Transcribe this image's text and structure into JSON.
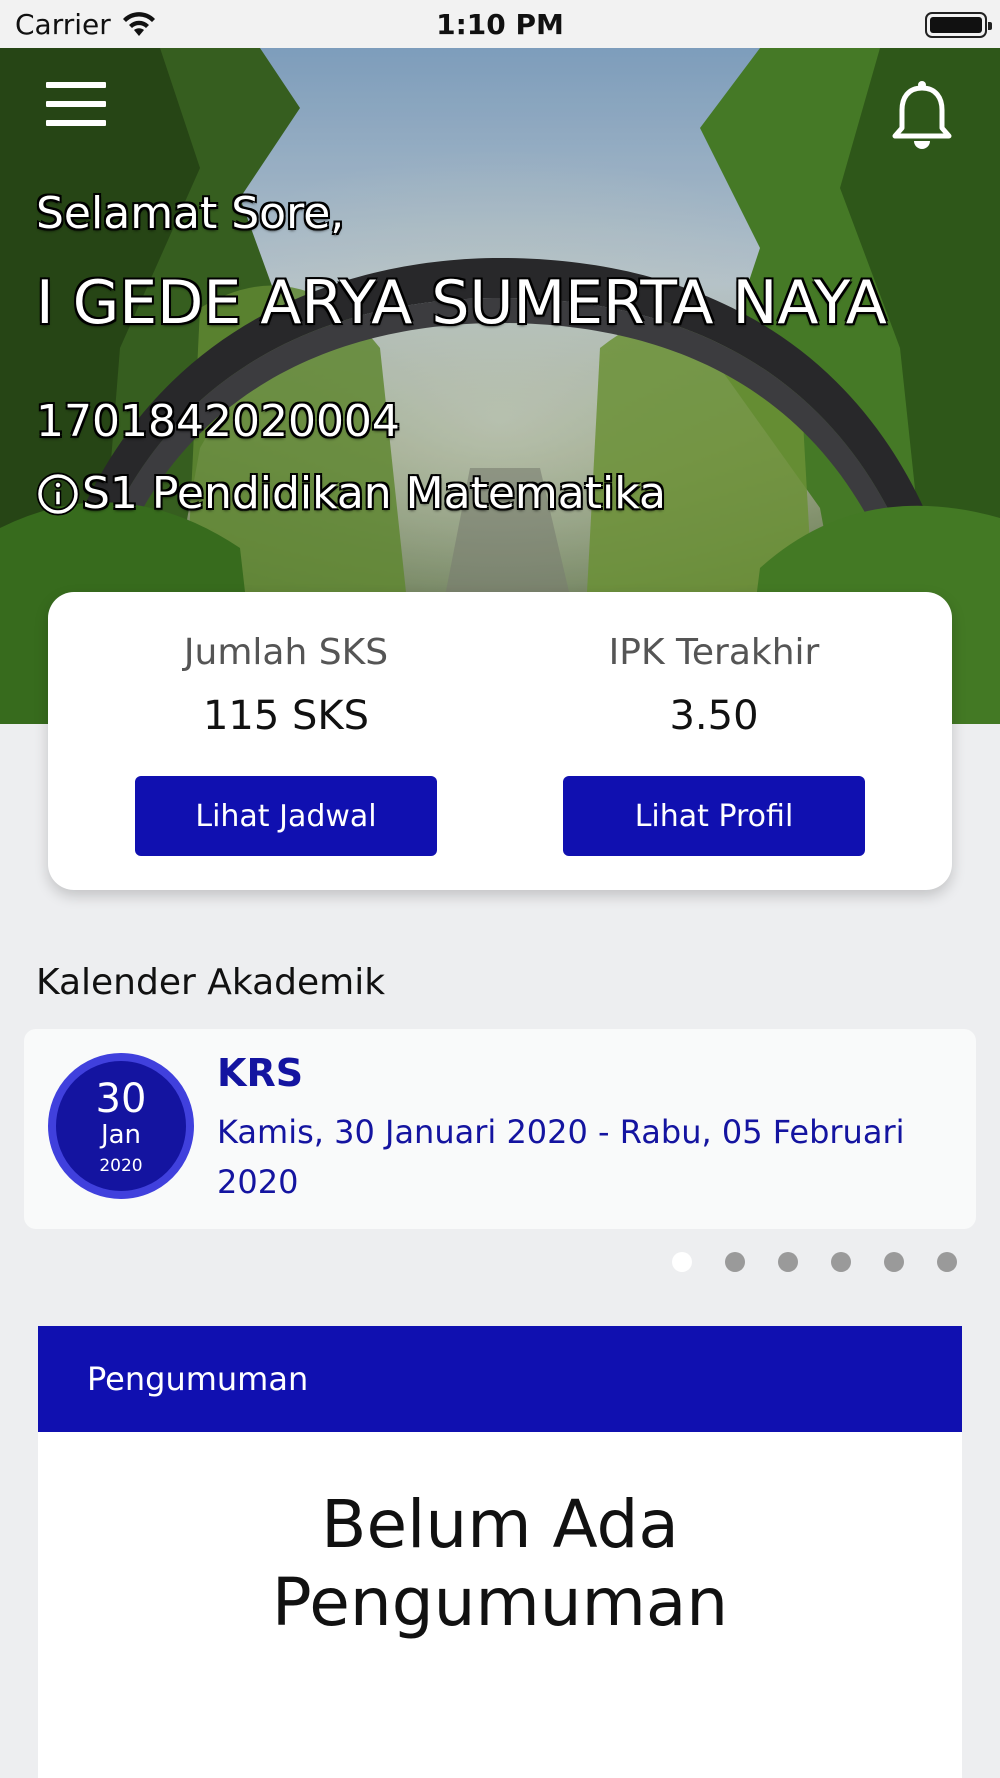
{
  "status_bar": {
    "carrier": "Carrier",
    "time": "1:10 PM"
  },
  "header": {
    "greeting": "Selamat Sore,",
    "name": "I GEDE ARYA SUMERTA NAYA",
    "student_id": "1701842020004",
    "program": "S1 Pendidikan Matematika"
  },
  "stats": {
    "credits_label": "Jumlah SKS",
    "credits_value": "115 SKS",
    "gpa_label": "IPK Terakhir",
    "gpa_value": "3.50",
    "schedule_button": "Lihat Jadwal",
    "profile_button": "Lihat Profil"
  },
  "calendar": {
    "title": "Kalender Akademik",
    "event": {
      "day": "30",
      "month": "Jan",
      "year": "2020",
      "name": "KRS",
      "dates": "Kamis, 30 Januari 2020 - Rabu, 05 Februari 2020"
    },
    "page_count": 6,
    "active_page": 1
  },
  "announcements": {
    "header": "Pengumuman",
    "empty_message": "Belum Ada Pengumuman"
  },
  "colors": {
    "primary": "#1010b0",
    "badge_ring": "#4040dd",
    "background": "#edeef0"
  },
  "icons": [
    "wifi-icon",
    "battery-icon",
    "menu-icon",
    "bell-icon",
    "info-icon"
  ]
}
